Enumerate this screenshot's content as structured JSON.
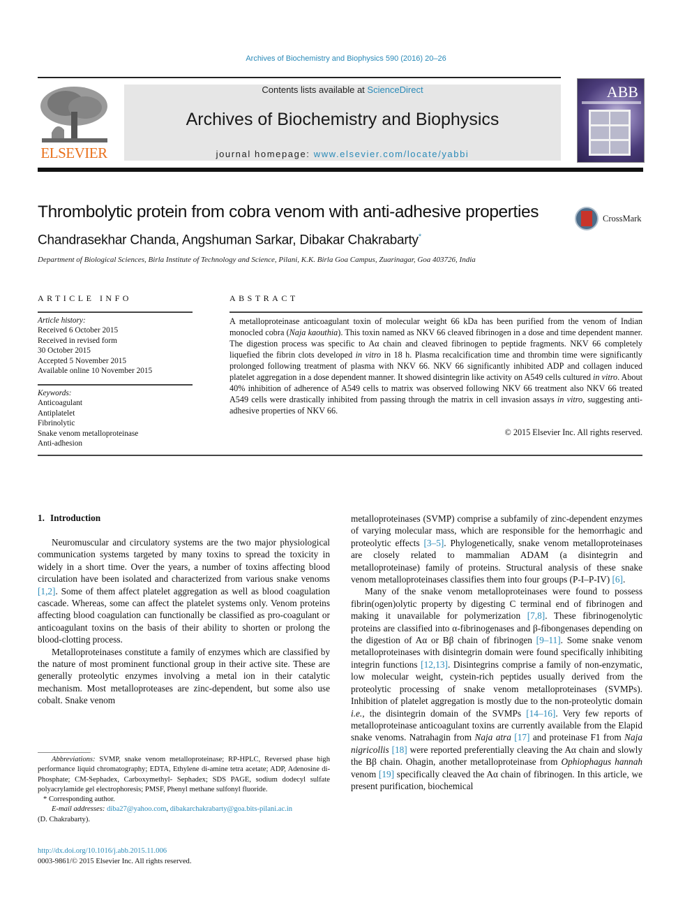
{
  "header": {
    "citation": "Archives of Biochemistry and Biophysics 590 (2016) 20–26",
    "publisher_logo_text": "ELSEVIER",
    "contents_prefix": "Contents lists available at ",
    "contents_link": "ScienceDirect",
    "journal_title": "Archives of Biochemistry and Biophysics",
    "homepage_prefix": "journal homepage: ",
    "homepage_link": "www.elsevier.com/locate/yabbi",
    "cover_text": "ABB"
  },
  "article": {
    "title": "Thrombolytic protein from cobra venom with anti-adhesive properties",
    "crossmark_label": "CrossMark",
    "authors": "Chandrasekhar Chanda, Angshuman Sarkar, Dibakar Chakrabarty",
    "author_mark": "*",
    "affiliation": "Department of Biological Sciences, Birla Institute of Technology and Science, Pilani, K.K. Birla Goa Campus, Zuarinagar, Goa 403726, India"
  },
  "article_info": {
    "heading": "ARTICLE INFO",
    "history_label": "Article history:",
    "history": [
      "Received 6 October 2015",
      "Received in revised form",
      "30 October 2015",
      "Accepted 5 November 2015",
      "Available online 10 November 2015"
    ],
    "keywords_label": "Keywords:",
    "keywords": [
      "Anticoagulant",
      "Antiplatelet",
      "Fibrinolytic",
      "Snake venom metalloproteinase",
      "Anti-adhesion"
    ]
  },
  "abstract": {
    "heading": "ABSTRACT",
    "p1": "A metalloproteinase anticoagulant toxin of molecular weight 66 kDa has been purified from the venom of Indian monocled cobra (",
    "species": "Naja kaouthia",
    "p2": "). This toxin named as NKV 66 cleaved fibrinogen in a dose and time dependent manner. The digestion process was specific to Aα chain and cleaved fibrinogen to peptide fragments. NKV 66 completely liquefied the fibrin clots developed ",
    "in_vitro": "in vitro",
    "p3": " in 18 h. Plasma recalcification time and thrombin time were significantly prolonged following treatment of plasma with NKV 66. NKV 66 significantly inhibited ADP and collagen induced platelet aggregation in a dose dependent manner. It showed disintegrin like activity on A549 cells cultured ",
    "p4": ". About 40% inhibition of adherence of A549 cells to matrix was observed following NKV 66 treatment also NKV 66 treated A549 cells were drastically inhibited from passing through the matrix in cell invasion assays ",
    "p5": ", suggesting anti-adhesive properties of NKV 66.",
    "copyright": "© 2015 Elsevier Inc. All rights reserved."
  },
  "introduction": {
    "number": "1.",
    "heading": "Introduction",
    "para1_a": "Neuromuscular and circulatory systems are the two major physiological communication systems targeted by many toxins to spread the toxicity in widely in a short time. Over the years, a number of toxins affecting blood circulation have been isolated and characterized from various snake venoms ",
    "ref_1_2": "[1,2]",
    "para1_b": ". Some of them affect platelet aggregation as well as blood coagulation cascade. Whereas, some can affect the platelet systems only. Venom proteins affecting blood coagulation can functionally be classified as pro-coagulant or anticoagulant toxins on the basis of their ability to shorten or prolong the blood-clotting process.",
    "para2": "Metalloproteinases constitute a family of enzymes which are classified by the nature of most prominent functional group in their active site. These are generally proteolytic enzymes involving a metal ion in their catalytic mechanism. Most metalloproteases are zinc-dependent, but some also use cobalt. Snake venom",
    "col2_p1_a": "metalloproteinases (SVMP) comprise a subfamily of zinc-dependent enzymes of varying molecular mass, which are responsible for the hemorrhagic and proteolytic effects ",
    "ref_3_5": "[3–5]",
    "col2_p1_b": ". Phylogenetically, snake venom metalloproteinases are closely related to mammalian ADAM (a disintegrin and metalloproteinase) family of proteins. Structural analysis of these snake venom metalloproteinases classifies them into four groups (P-I–P-IV) ",
    "ref_6": "[6]",
    "col2_p1_c": ".",
    "col2_p2_a": "Many of the snake venom metalloproteinases were found to possess fibrin(ogen)olytic property by digesting C terminal end of fibrinogen and making it unavailable for polymerization ",
    "ref_7_8": "[7,8]",
    "col2_p2_b": ". These fibrinogenolytic proteins are classified into α-fibrinogenases and β-fibongenases depending on the digestion of Aα or Bβ chain of fibrinogen ",
    "ref_9_11": "[9–11]",
    "col2_p2_c": ". Some snake venom metalloproteinases with disintegrin domain were found specifically inhibiting integrin functions ",
    "ref_12_13": "[12,13]",
    "col2_p2_d": ". Disintegrins comprise a family of non-enzymatic, low molecular weight, cystein-rich peptides usually derived from the proteolytic processing of snake venom metalloproteinases (SVMPs). Inhibition of platelet aggregation is mostly due to the non-proteolytic domain ",
    "ie": "i.e.",
    "col2_p2_e": ", the disintegrin domain of the SVMPs ",
    "ref_14_16": "[14–16]",
    "col2_p2_f": ". Very few reports of metalloproteinase anticoagulant toxins are currently available from the Elapid snake venoms. Natrahagin from ",
    "naja_atra": "Naja atra",
    "ref_17": "[17]",
    "col2_p2_g": " and proteinase F1 from ",
    "naja_nig": "Naja nigricollis",
    "ref_18": "[18]",
    "col2_p2_h": " were reported preferentially cleaving the Aα chain and slowly the Bβ chain. Ohagin, another metalloproteinase from ",
    "ophiophagus": "Ophiophagus hannah",
    "col2_p2_i": " venom ",
    "ref_19": "[19]",
    "col2_p2_j": " specifically cleaved the Aα chain of fibrinogen. In this article, we present purification, biochemical"
  },
  "footnotes": {
    "abbrev_label": "Abbreviations:",
    "abbrev_text": " SVMP, snake venom metalloproteinase; RP-HPLC, Reversed phase high performance liquid chromatography; EDTA, Ethylene di-amine tetra acetate; ADP, Adenosine di-Phosphate; CM-Sephadex, Carboxymethyl- Sephadex; SDS PAGE, sodium dodecyl sulfate polyacrylamide gel electrophoresis; PMSF, Phenyl methane sulfonyl fluoride.",
    "corresponding": "* Corresponding author.",
    "email_label": "E-mail addresses:",
    "email1": "diba27@yahoo.com",
    "email_sep": ", ",
    "email2": "dibakarchakrabarty@goa.bits-pilani.ac.in",
    "email_owner": "(D. Chakrabarty).",
    "doi": "http://dx.doi.org/10.1016/j.abb.2015.11.006",
    "issn_line": "0003-9861/© 2015 Elsevier Inc. All rights reserved."
  },
  "colors": {
    "link": "#2a8ab8",
    "elsevier_orange": "#e9711c",
    "banner_gray": "#e6e6e6"
  }
}
